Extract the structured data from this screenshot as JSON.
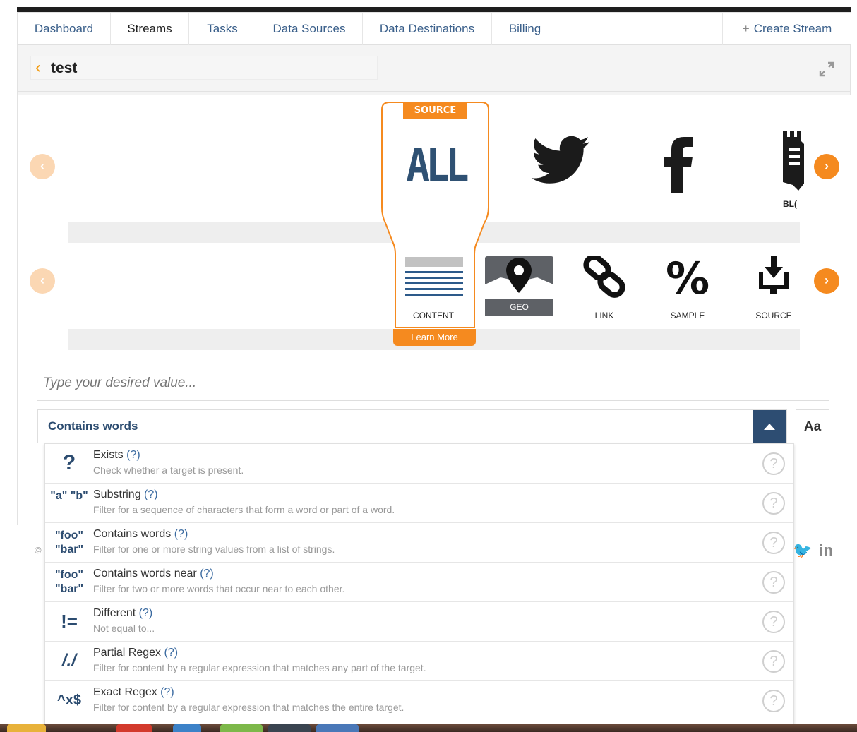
{
  "nav": {
    "items": [
      {
        "label": "Dashboard",
        "active": false
      },
      {
        "label": "Streams",
        "active": true
      },
      {
        "label": "Tasks",
        "active": false
      },
      {
        "label": "Data Sources",
        "active": false
      },
      {
        "label": "Data Destinations",
        "active": false
      },
      {
        "label": "Billing",
        "active": false
      }
    ],
    "create_label": "Create Stream"
  },
  "stream": {
    "back_icon": "chevron-left-icon",
    "title": "test"
  },
  "sources": {
    "card_tag": "SOURCE",
    "selected_label": "ALL",
    "items": [
      {
        "name": "twitter",
        "icon": "twitter-bird-icon"
      },
      {
        "name": "facebook",
        "icon": "facebook-f-icon"
      },
      {
        "name": "blog",
        "icon": "blog-tower-icon",
        "label": "BL("
      }
    ]
  },
  "filters": {
    "learn_more": "Learn More",
    "items": [
      {
        "label": "CONTENT",
        "icon": "content-lines-icon"
      },
      {
        "label": "GEO",
        "icon": "map-pin-icon"
      },
      {
        "label": "LINK",
        "icon": "chain-link-icon"
      },
      {
        "label": "SAMPLE",
        "icon": "percent-icon"
      },
      {
        "label": "SOURCE",
        "icon": "download-tray-icon"
      }
    ]
  },
  "value_input": {
    "placeholder": "Type your desired value..."
  },
  "condition": {
    "selected": "Contains words",
    "case_label": "Aa",
    "options": [
      {
        "icon_text": "?",
        "title": "Exists",
        "help": "(?)",
        "desc": "Check whether a target is present."
      },
      {
        "icon_text": "\"a\" \"b\"",
        "title": "Substring",
        "help": "(?)",
        "desc": "Filter for a sequence of characters that form a word or part of a word."
      },
      {
        "icon_text": "\"foo\" \"bar\"",
        "title": "Contains words",
        "help": "(?)",
        "desc": "Filter for one or more string values from a list of strings."
      },
      {
        "icon_text": "\"foo\" \"bar\"",
        "title": "Contains words near",
        "help": "(?)",
        "desc": "Filter for two or more words that occur near to each other."
      },
      {
        "icon_text": "!=",
        "title": "Different",
        "help": "(?)",
        "desc": "Not equal to..."
      },
      {
        "icon_text": "/./",
        "title": "Partial Regex",
        "help": "(?)",
        "desc": "Filter for content by a regular expression that matches any part of the target."
      },
      {
        "icon_text": "^x$",
        "title": "Exact Regex",
        "help": "(?)",
        "desc": "Filter for content by a regular expression that matches the entire target."
      }
    ]
  },
  "footer": {
    "copyright": "©"
  },
  "colors": {
    "accent": "#f58a1f",
    "navy": "#2d4d72"
  }
}
